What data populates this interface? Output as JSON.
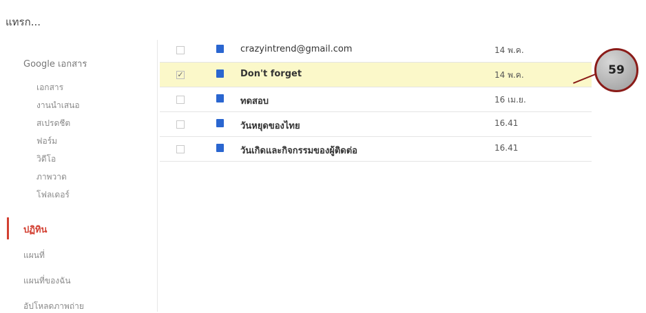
{
  "dialog": {
    "title": "แทรก..."
  },
  "sidebar": {
    "root_label": "Google เอกสาร",
    "sub_items": [
      "เอกสาร",
      "งานนำเสนอ",
      "สเปรดชีต",
      "ฟอร์ม",
      "วิดีโอ",
      "ภาพวาด",
      "โฟลเดอร์"
    ],
    "active_item": "ปฏิทิน",
    "more_items": [
      "แผนที่",
      "แผนที่ของฉัน",
      "อัปโหลดภาพถ่าย"
    ]
  },
  "list": {
    "rows": [
      {
        "title": "crazyintrend@gmail.com",
        "date": "14 พ.ค.",
        "checked": false,
        "selected": false,
        "bold": false
      },
      {
        "title": "Don't forget",
        "date": "14 พ.ค.",
        "checked": true,
        "selected": true,
        "bold": true
      },
      {
        "title": "ทดสอบ",
        "date": "16 เม.ย.",
        "checked": false,
        "selected": false,
        "bold": true
      },
      {
        "title": "วันหยุดของไทย",
        "date": "16.41",
        "checked": false,
        "selected": false,
        "bold": true
      },
      {
        "title": "วันเกิดและกิจกรรมของผู้ติดต่อ",
        "date": "16.41",
        "checked": false,
        "selected": false,
        "bold": true
      }
    ]
  },
  "callout": {
    "label": "59"
  },
  "colors": {
    "accent": "#d23f31",
    "doc_icon": "#2a66d0",
    "selected_row": "#fbf8c9"
  }
}
